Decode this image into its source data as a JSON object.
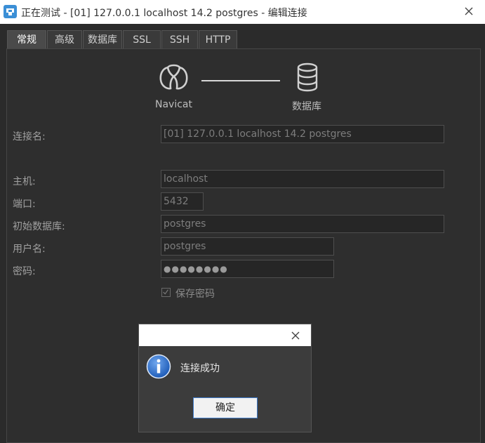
{
  "window": {
    "title": "正在测试 - [01] 127.0.0.1 localhost 14.2 postgres - 编辑连接"
  },
  "tabs": [
    "常规",
    "高级",
    "数据库",
    "SSL",
    "SSH",
    "HTTP"
  ],
  "diagram": {
    "left_label": "Navicat",
    "right_label": "数据库"
  },
  "form": {
    "connection_name_label": "连接名:",
    "connection_name_value": "[01] 127.0.0.1 localhost 14.2 postgres",
    "host_label": "主机:",
    "host_value": "localhost",
    "port_label": "端口:",
    "port_value": "5432",
    "initial_db_label": "初始数据库:",
    "initial_db_value": "postgres",
    "username_label": "用户名:",
    "username_value": "postgres",
    "password_label": "密码:",
    "password_value": "●●●●●●●●",
    "save_password_label": "保存密码",
    "save_password_checked": true
  },
  "dialog": {
    "message": "连接成功",
    "ok_label": "确定"
  },
  "colors": {
    "background": "#2b2b2b",
    "titlebar": "#ffffff",
    "button_border": "#3d7ac9",
    "info_icon": "#1e5cb8"
  }
}
